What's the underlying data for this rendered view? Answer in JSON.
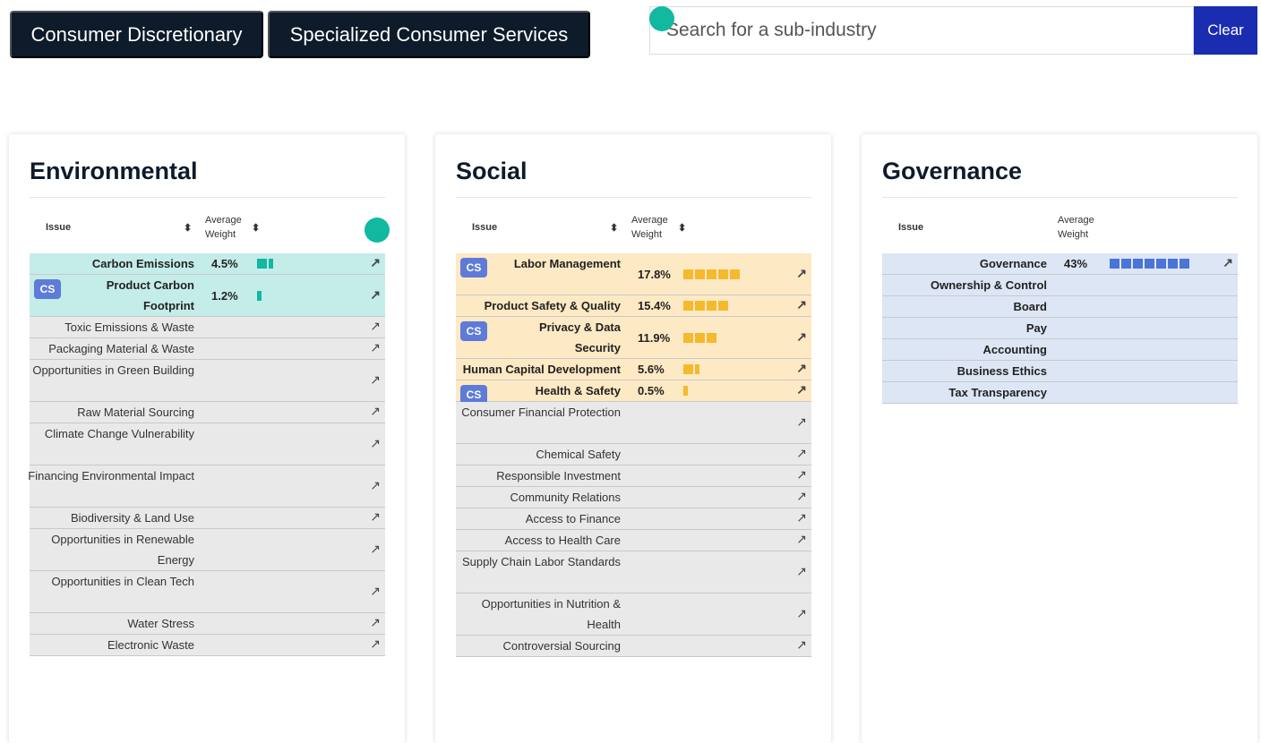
{
  "breadcrumbs": [
    "Consumer Discretionary",
    "Specialized Consumer Services"
  ],
  "search": {
    "placeholder": "Search for a sub-industry",
    "clear_label": "Clear"
  },
  "colors": {
    "env": "#10b9a0",
    "social": "#f5b92e",
    "gov": "#4a74d6",
    "navy": "#0d1b2a",
    "clear_btn": "#1a2cb0"
  },
  "table_headers": {
    "issue": "Issue",
    "weight_line1": "Average",
    "weight_line2": "Weight"
  },
  "cs_badge": "CS",
  "environmental": {
    "title": "Environmental",
    "rows": [
      {
        "issue": "Carbon Emissions",
        "weight": "4.5%",
        "segments": 2,
        "cs": false,
        "highlight": true
      },
      {
        "issue": "Product Carbon Footprint",
        "weight": "1.2%",
        "segments": 1,
        "cs": true,
        "highlight": true
      },
      {
        "issue": "Toxic Emissions & Waste",
        "weight": "",
        "segments": 0,
        "cs": false,
        "highlight": false
      },
      {
        "issue": "Packaging Material & Waste",
        "weight": "",
        "segments": 0,
        "cs": false,
        "highlight": false
      },
      {
        "issue": "Opportunities in Green Building",
        "weight": "",
        "segments": 0,
        "cs": false,
        "highlight": false
      },
      {
        "issue": "Raw Material Sourcing",
        "weight": "",
        "segments": 0,
        "cs": false,
        "highlight": false
      },
      {
        "issue": "Climate Change Vulnerability",
        "weight": "",
        "segments": 0,
        "cs": false,
        "highlight": false
      },
      {
        "issue": "Financing Environmental Impact",
        "weight": "",
        "segments": 0,
        "cs": false,
        "highlight": false
      },
      {
        "issue": "Biodiversity & Land Use",
        "weight": "",
        "segments": 0,
        "cs": false,
        "highlight": false
      },
      {
        "issue": "Opportunities in Renewable Energy",
        "weight": "",
        "segments": 0,
        "cs": false,
        "highlight": false
      },
      {
        "issue": "Opportunities in Clean Tech",
        "weight": "",
        "segments": 0,
        "cs": false,
        "highlight": false
      },
      {
        "issue": "Water Stress",
        "weight": "",
        "segments": 0,
        "cs": false,
        "highlight": false
      },
      {
        "issue": "Electronic Waste",
        "weight": "",
        "segments": 0,
        "cs": false,
        "highlight": false
      }
    ]
  },
  "social": {
    "title": "Social",
    "rows": [
      {
        "issue": "Labor Management",
        "weight": "17.8%",
        "segments": 5,
        "cs": true,
        "highlight": true
      },
      {
        "issue": "Product Safety & Quality",
        "weight": "15.4%",
        "segments": 4,
        "cs": false,
        "highlight": true
      },
      {
        "issue": "Privacy & Data Security",
        "weight": "11.9%",
        "segments": 3,
        "cs": true,
        "highlight": true
      },
      {
        "issue": "Human Capital Development",
        "weight": "5.6%",
        "segments": 2,
        "cs": false,
        "highlight": true
      },
      {
        "issue": "Health & Safety",
        "weight": "0.5%",
        "segments": 1,
        "cs": true,
        "highlight": true
      },
      {
        "issue": "Consumer Financial Protection",
        "weight": "",
        "segments": 0,
        "cs": false,
        "highlight": false
      },
      {
        "issue": "Chemical Safety",
        "weight": "",
        "segments": 0,
        "cs": false,
        "highlight": false
      },
      {
        "issue": "Responsible Investment",
        "weight": "",
        "segments": 0,
        "cs": false,
        "highlight": false
      },
      {
        "issue": "Community Relations",
        "weight": "",
        "segments": 0,
        "cs": false,
        "highlight": false
      },
      {
        "issue": "Access to Finance",
        "weight": "",
        "segments": 0,
        "cs": false,
        "highlight": false
      },
      {
        "issue": "Access to Health Care",
        "weight": "",
        "segments": 0,
        "cs": false,
        "highlight": false
      },
      {
        "issue": "Supply Chain Labor Standards",
        "weight": "",
        "segments": 0,
        "cs": false,
        "highlight": false
      },
      {
        "issue": "Opportunities in Nutrition & Health",
        "weight": "",
        "segments": 0,
        "cs": false,
        "highlight": false
      },
      {
        "issue": "Controversial Sourcing",
        "weight": "",
        "segments": 0,
        "cs": false,
        "highlight": false
      }
    ]
  },
  "governance": {
    "title": "Governance",
    "rows": [
      {
        "issue": "Governance",
        "weight": "43%",
        "segments": 7,
        "cs": false,
        "highlight": true
      },
      {
        "issue": "Ownership & Control",
        "weight": "",
        "segments": 0,
        "cs": false,
        "highlight": true
      },
      {
        "issue": "Board",
        "weight": "",
        "segments": 0,
        "cs": false,
        "highlight": true
      },
      {
        "issue": "Pay",
        "weight": "",
        "segments": 0,
        "cs": false,
        "highlight": true
      },
      {
        "issue": "Accounting",
        "weight": "",
        "segments": 0,
        "cs": false,
        "highlight": true
      },
      {
        "issue": "Business Ethics",
        "weight": "",
        "segments": 0,
        "cs": false,
        "highlight": true
      },
      {
        "issue": "Tax Transparency",
        "weight": "",
        "segments": 0,
        "cs": false,
        "highlight": true
      }
    ]
  }
}
